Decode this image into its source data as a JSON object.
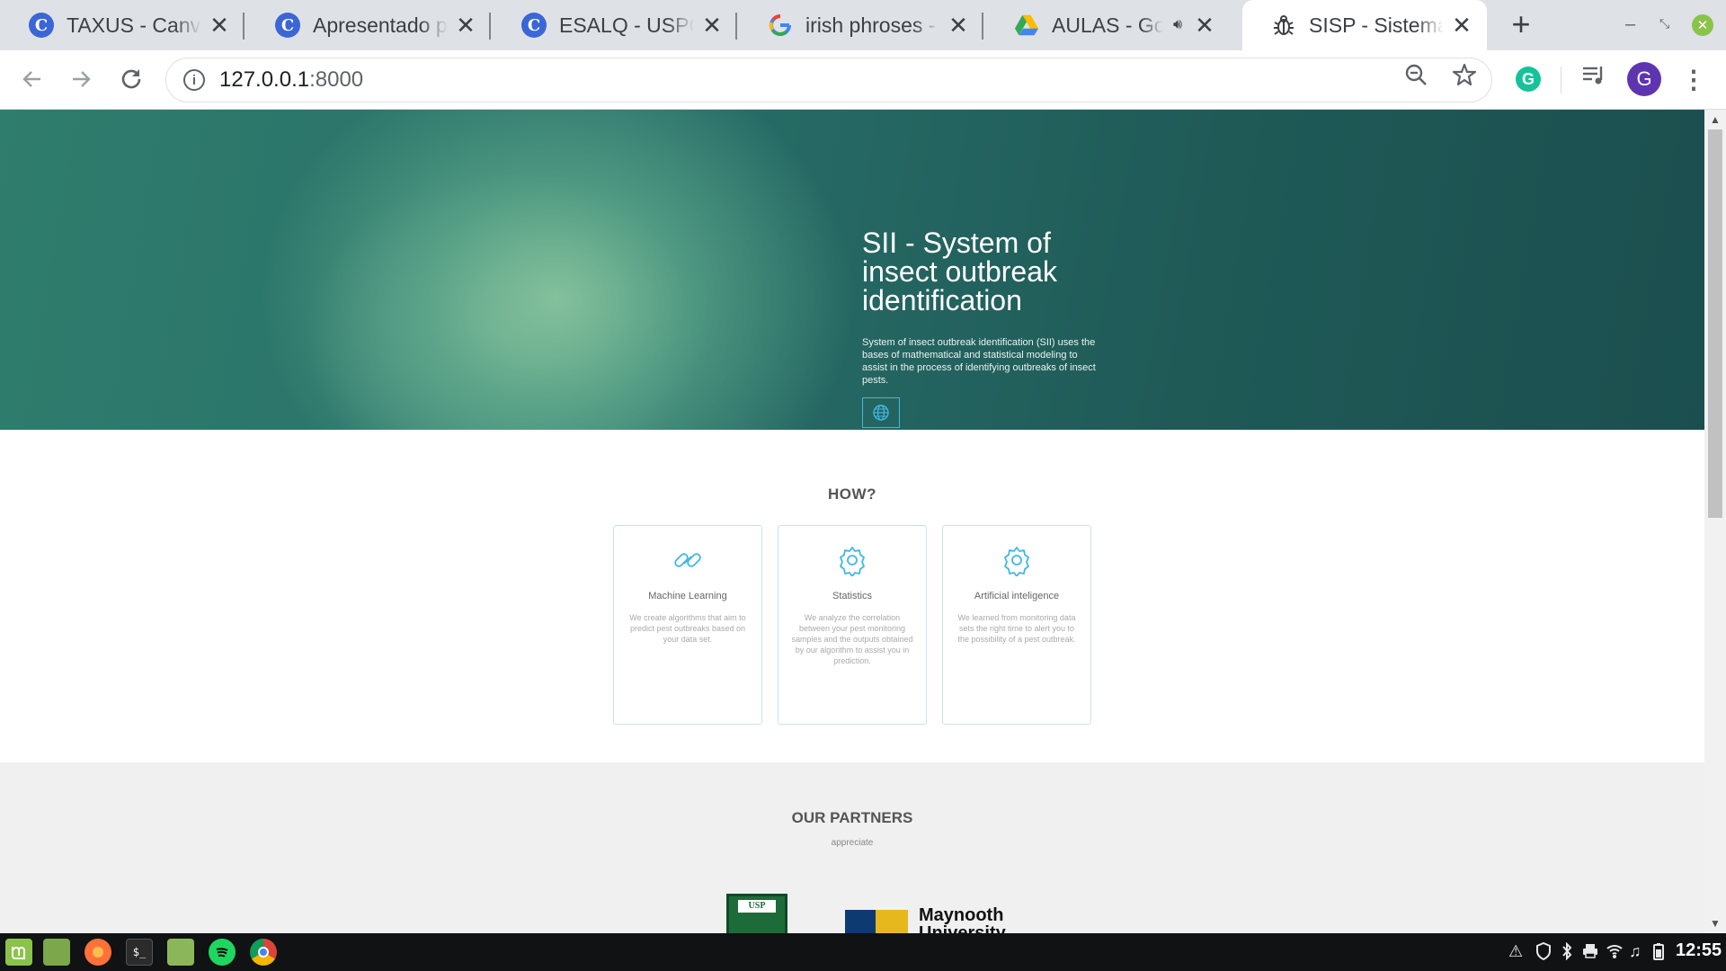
{
  "browser": {
    "tabs": [
      {
        "title": "TAXUS - Canva",
        "icon": "canva-icon",
        "active": false
      },
      {
        "title": "Apresentado por",
        "icon": "canva-icon",
        "active": false
      },
      {
        "title": "ESALQ - USPCiência",
        "icon": "canva-icon",
        "active": false
      },
      {
        "title": "irish phroses - Pesquisa",
        "icon": "google-icon",
        "active": false
      },
      {
        "title": "AULAS - Google Drive",
        "icon": "google-drive-icon",
        "active": false,
        "audio": true
      },
      {
        "title": "SISP - Sistema de",
        "icon": "bug-icon",
        "active": true
      }
    ],
    "url_host": "127.0.0.1",
    "url_port": ":8000",
    "avatar_letter": "G",
    "extension_letter": "G"
  },
  "hero": {
    "title": "SII - System of insect outbreak identification",
    "description": "System of insect outbreak identification (SII) uses the bases of mathematical and statistical modeling to assist in the process of identifying outbreaks of insect pests.",
    "button_icon": "globe-icon"
  },
  "how": {
    "title": "HOW?",
    "cards": [
      {
        "icon": "link-icon",
        "title": "Machine Learning",
        "description": "We create algorithms that aim to predict pest outbreaks based on your data set."
      },
      {
        "icon": "gear-icon",
        "title": "Statistics",
        "description": "We analyze the correlation between your pest monitoring samples and the outputs obtained by our algorithm to assist you in prediction."
      },
      {
        "icon": "gear-icon",
        "title": "Artificial inteligence",
        "description": "We learned from monitoring data sets the right time to alert you to the possibility of a pest outbreak."
      }
    ]
  },
  "partners": {
    "title": "OUR PARTNERS",
    "subtitle": "appreciate",
    "logos": [
      {
        "name": "usp-logo",
        "text": "USP"
      },
      {
        "name": "maynooth-logo",
        "text": "Maynooth University"
      }
    ]
  },
  "taskbar": {
    "apps": [
      "mint-menu-icon",
      "desktop-icon",
      "firefox-icon",
      "terminal-icon",
      "files-icon",
      "spotify-icon",
      "chrome-icon"
    ],
    "clock": "12:55"
  },
  "colors": {
    "accent": "#3fb7e6",
    "hero_dark": "#1b4f4f",
    "hero_light": "#8cc8a0"
  }
}
